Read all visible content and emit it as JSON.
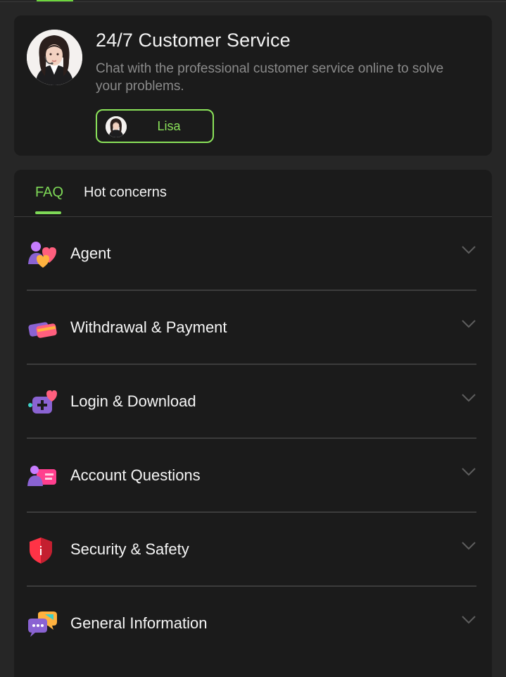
{
  "service": {
    "title": "24/7 Customer Service",
    "description": "Chat with the professional customer service online to solve your problems.",
    "agent_name": "Lisa"
  },
  "tabs": [
    {
      "label": "FAQ",
      "active": true
    },
    {
      "label": "Hot concerns",
      "active": false
    }
  ],
  "faq_items": [
    {
      "label": "Agent",
      "icon": "agent-icon"
    },
    {
      "label": "Withdrawal & Payment",
      "icon": "cards-icon"
    },
    {
      "label": "Login & Download",
      "icon": "game-controller-icon"
    },
    {
      "label": "Account Questions",
      "icon": "account-card-icon"
    },
    {
      "label": "Security & Safety",
      "icon": "shield-icon"
    },
    {
      "label": "General Information",
      "icon": "chat-bubbles-icon"
    }
  ],
  "colors": {
    "accent": "#7ed957",
    "background": "#262626",
    "card": "#1b1b1b"
  }
}
